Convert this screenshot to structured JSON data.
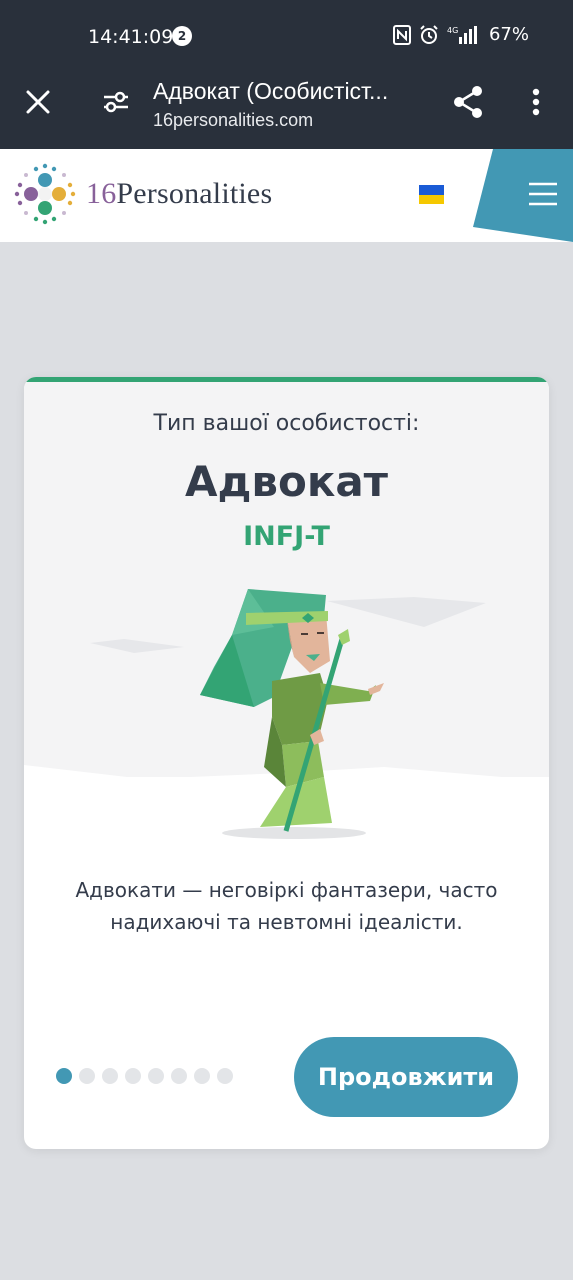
{
  "status_bar": {
    "time": "14:41:09",
    "notification_count": "2",
    "battery": "67%",
    "network": "4G"
  },
  "browser": {
    "page_title": "Адвокат (Особистіст...",
    "url": "16personalities.com"
  },
  "site": {
    "logo_number": "16",
    "logo_word": "Personalities",
    "flag": "ukraine-flag-icon"
  },
  "card": {
    "subtitle": "Тип вашої особистості:",
    "type_name": "Адвокат",
    "type_code": "INFJ-T",
    "description": "Адвокати — неговіркі фантазери, часто надихаючі та невтомні ідеалісти.",
    "continue_label": "Продовжити",
    "pagination": {
      "total": 8,
      "active": 1
    }
  },
  "colors": {
    "accent_green": "#33a474",
    "accent_blue": "#4298b4",
    "text_dark": "#343c4b",
    "chrome_bg": "#29303b"
  }
}
